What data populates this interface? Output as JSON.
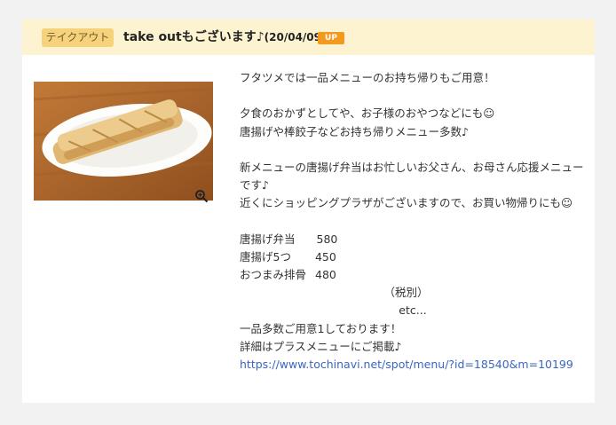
{
  "post": {
    "tag": "テイクアウト",
    "title": "take outもございます♪",
    "date": "(20/04/09)",
    "badge": "UP"
  },
  "content": {
    "intro": "フタツメでは一品メニューのお持ち帰りもご用意！",
    "p1_l1": "夕食のおかずとしてや、お子様のおやつなどにも☺",
    "p1_l2": "唐揚げや棒餃子などお持ち帰りメニュー多数♪",
    "p2_l1": "新メニューの唐揚げ弁当はお忙しいお父さん、お母さん応援メニュー",
    "p2_l2": "です♪",
    "p2_l3": "近くにショッピングプラザがございますので、お買い物帰りにも☺",
    "menu": [
      {
        "name": "唐揚げ弁当",
        "price": "580"
      },
      {
        "name": "唐揚げ5つ",
        "price": "450"
      },
      {
        "name": "おつまみ排骨",
        "price": "480"
      }
    ],
    "tax_note": "（税別）",
    "etc": "etc...",
    "closing1": "一品多数ご用意1しております！",
    "closing2": "詳細はプラスメニューにご掲載♪",
    "link": "https://www.tochinavi.net/spot/menu/?id=18540&m=10199"
  }
}
